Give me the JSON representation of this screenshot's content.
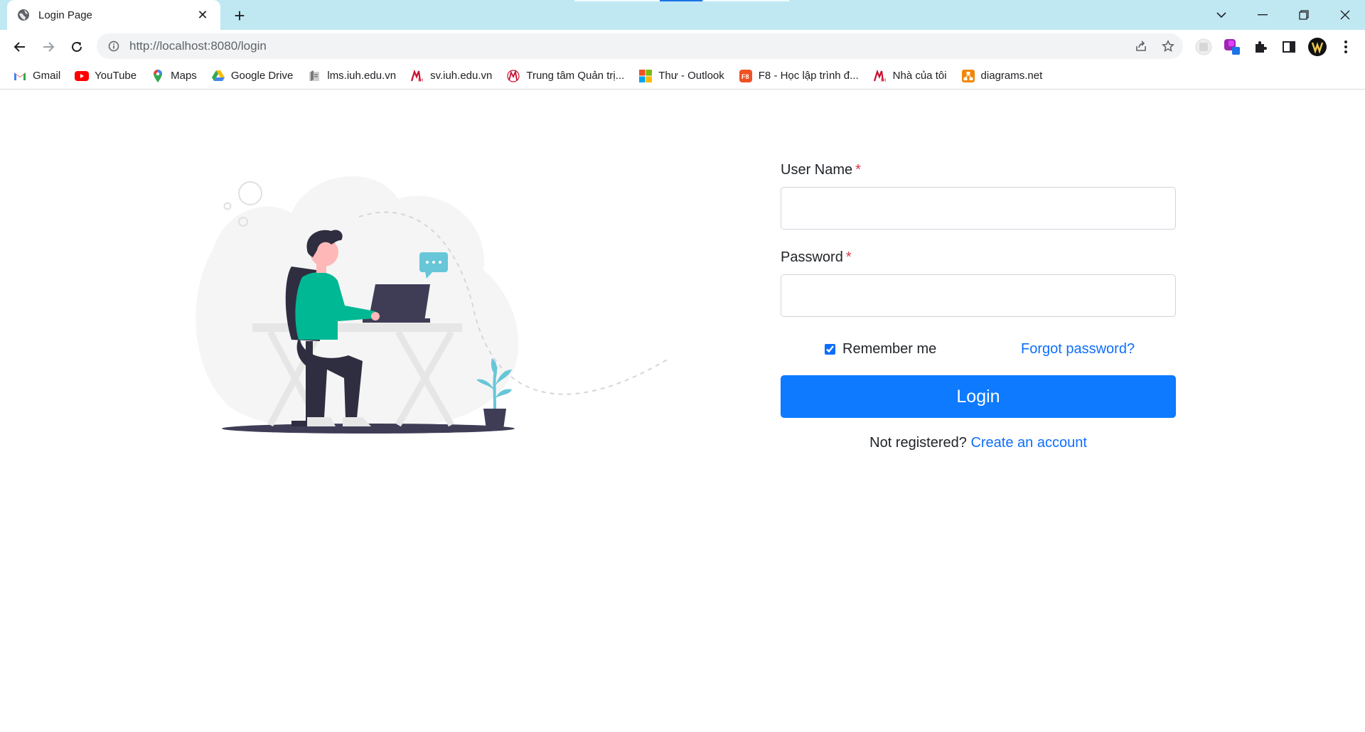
{
  "browser": {
    "tab": {
      "title": "Login Page"
    },
    "address_bar": {
      "url": "http://localhost:8080/login"
    }
  },
  "bookmarks": [
    {
      "label": "Gmail",
      "icon": "gmail-icon"
    },
    {
      "label": "YouTube",
      "icon": "youtube-icon"
    },
    {
      "label": "Maps",
      "icon": "maps-icon"
    },
    {
      "label": "Google Drive",
      "icon": "drive-icon"
    },
    {
      "label": "lms.iuh.edu.vn",
      "icon": "lms-icon"
    },
    {
      "label": "sv.iuh.edu.vn",
      "icon": "iuh-icon"
    },
    {
      "label": "Trung tâm Quản trị...",
      "icon": "iuh-icon"
    },
    {
      "label": "Thư - Outlook",
      "icon": "microsoft-icon"
    },
    {
      "label": "F8 - Học lập trình đ...",
      "icon": "f8-icon"
    },
    {
      "label": "Nhà của tôi",
      "icon": "iuh-icon"
    },
    {
      "label": "diagrams.net",
      "icon": "diagrams-icon"
    }
  ],
  "form": {
    "username_label": "User Name",
    "password_label": "Password",
    "required_mark": "*",
    "username_value": "",
    "password_value": "",
    "remember_label": "Remember me",
    "remember_checked": true,
    "forgot_label": "Forgot password?",
    "login_label": "Login",
    "register_prompt": "Not registered?",
    "register_link": "Create an account"
  },
  "colors": {
    "primary": "#0d7aff",
    "link": "#0d6efd",
    "required": "#dc3545",
    "tabstrip": "#bfe8f3",
    "illustration_accent": "#00b894"
  }
}
